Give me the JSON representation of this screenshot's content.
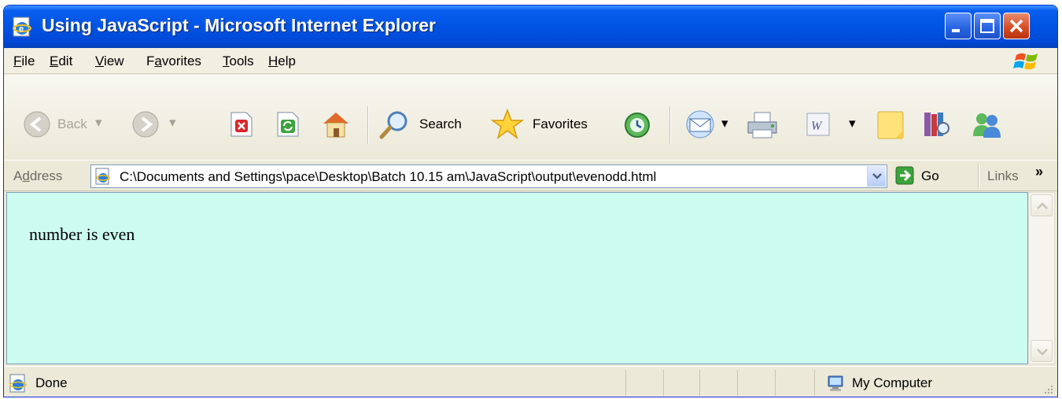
{
  "window": {
    "title": "Using JavaScript - Microsoft Internet Explorer"
  },
  "menu": {
    "items": [
      {
        "underline": "F",
        "rest": "ile"
      },
      {
        "underline": "E",
        "rest": "dit"
      },
      {
        "underline": "V",
        "rest": "iew"
      },
      {
        "prefix": "F",
        "underline": "a",
        "rest": "vorites"
      },
      {
        "underline": "T",
        "rest": "ools"
      },
      {
        "underline": "H",
        "rest": "elp"
      }
    ]
  },
  "toolbar": {
    "back_label": "Back",
    "search_label": "Search",
    "favorites_label": "Favorites"
  },
  "address": {
    "label_underline": "d",
    "label_prefix": "A",
    "label_rest": "dress",
    "url": "C:\\Documents and Settings\\pace\\Desktop\\Batch 10.15 am\\JavaScript\\output\\evenodd.html",
    "go_label": "Go",
    "links_label": "Links",
    "more": "»"
  },
  "content": {
    "text": "number is even",
    "background": "#ccfbf0"
  },
  "status": {
    "text": "Done",
    "zone": "My Computer"
  }
}
